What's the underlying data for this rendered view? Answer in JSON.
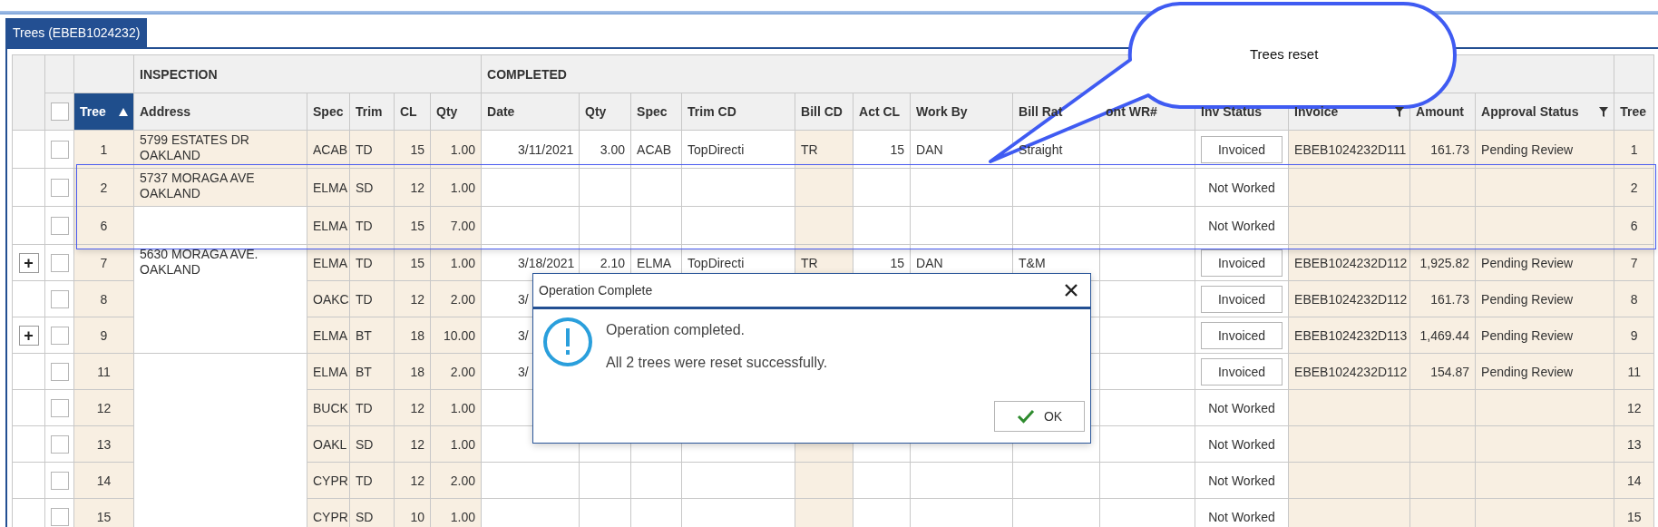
{
  "tab": {
    "label": "Trees (EBEB1024232)",
    "selected": true
  },
  "table": {
    "select_all_checked": false,
    "lead_column": {
      "label": "Tree",
      "sorted": true
    },
    "groups": [
      {
        "label": "INSPECTION",
        "columns": [
          {
            "label": "Address",
            "filter": false
          },
          {
            "label": "Spec",
            "filter": false
          },
          {
            "label": "Trim",
            "filter": false
          },
          {
            "label": "CL",
            "filter": false
          },
          {
            "label": "Qty",
            "filter": false
          }
        ]
      },
      {
        "label": "COMPLETED",
        "columns": [
          {
            "label": "Date",
            "filter": false
          },
          {
            "label": "Qty",
            "filter": false
          },
          {
            "label": "Spec",
            "filter": false
          },
          {
            "label": "Trim CD",
            "filter": false
          },
          {
            "label": "Bill CD",
            "filter": false
          },
          {
            "label": "Act CL",
            "filter": false
          },
          {
            "label": "Work By",
            "filter": false
          },
          {
            "label": "Bill Rat",
            "filter": false
          },
          {
            "label": "ont WR#",
            "filter": false
          },
          {
            "label": "Inv Status",
            "filter": false
          },
          {
            "label": "Invoice",
            "filter": true
          },
          {
            "label": "Amount",
            "filter": false
          },
          {
            "label": "Approval Status",
            "filter": true
          }
        ]
      }
    ],
    "tail_column": {
      "label": "Tree"
    },
    "row_groups": [
      {
        "address": "5799 ESTATES DR\nOAKLAND",
        "highlighted": true,
        "rows": [
          {
            "checked": false,
            "tree": "1",
            "spec": "ACAB",
            "trim": "TD",
            "cl": "15",
            "qty": "1.00",
            "date": "3/11/2021",
            "done_qty": "3.00",
            "done_spec": "ACAB",
            "trim_cd": "TopDirecti",
            "bill_cd": "TR",
            "act_cl": "15",
            "work_by": "DAN",
            "bill_rate": "Straight",
            "inv_status": {
              "text": "Invoiced",
              "kind": "button"
            },
            "invoice": "EBEB1024232D111",
            "amount": "161.73",
            "approval": "Pending Review",
            "tree_end": "1"
          }
        ]
      },
      {
        "address": "5737 MORAGA AVE\nOAKLAND",
        "highlighted": true,
        "rows": [
          {
            "checked": false,
            "tree": "2",
            "spec": "ELMA",
            "trim": "SD",
            "cl": "12",
            "qty": "1.00",
            "inv_status": {
              "text": "Not Worked",
              "kind": "plain"
            },
            "tree_end": "2"
          }
        ]
      },
      {
        "highlighted": false,
        "rows": [
          {
            "checked": false,
            "tree": "6",
            "spec": "ELMA",
            "trim": "TD",
            "cl": "15",
            "qty": "7.00",
            "inv_status": {
              "text": "Not Worked",
              "kind": "plain"
            },
            "tree_end": "6"
          }
        ]
      },
      {
        "address": "5630 MORAGA AVE.\nOAKLAND",
        "highlighted": false,
        "rows": [
          {
            "expander": "+",
            "checked": false,
            "tree": "7",
            "spec": "ELMA",
            "trim": "TD",
            "cl": "15",
            "qty": "1.00",
            "date": "3/18/2021",
            "done_qty": "2.10",
            "done_spec": "ELMA",
            "trim_cd": "TopDirecti",
            "bill_cd": "TR",
            "act_cl": "15",
            "work_by": "DAN",
            "bill_rate": "T&M",
            "inv_status": {
              "text": "Invoiced",
              "kind": "button"
            },
            "invoice": "EBEB1024232D112",
            "amount": "1,925.82",
            "approval": "Pending Review",
            "tree_end": "7"
          },
          {
            "checked": false,
            "tree": "8",
            "spec": "OAKC",
            "trim": "TD",
            "cl": "12",
            "qty": "2.00",
            "date": "3/",
            "inv_status": {
              "text": "Invoiced",
              "kind": "button"
            },
            "invoice": "EBEB1024232D112",
            "amount": "161.73",
            "approval": "Pending Review",
            "tree_end": "8"
          },
          {
            "expander": "+",
            "checked": false,
            "tree": "9",
            "spec": "ELMA",
            "trim": "BT",
            "cl": "18",
            "qty": "10.00",
            "date": "3/",
            "inv_status": {
              "text": "Invoiced",
              "kind": "button"
            },
            "invoice": "EBEB1024232D113",
            "amount": "1,469.44",
            "approval": "Pending Review",
            "tree_end": "9"
          }
        ]
      },
      {
        "highlighted": false,
        "rows": [
          {
            "checked": false,
            "tree": "11",
            "spec": "ELMA",
            "trim": "BT",
            "cl": "18",
            "qty": "2.00",
            "date": "3/",
            "inv_status": {
              "text": "Invoiced",
              "kind": "button"
            },
            "invoice": "EBEB1024232D112",
            "amount": "154.87",
            "approval": "Pending Review",
            "tree_end": "11"
          },
          {
            "checked": false,
            "tree": "12",
            "spec": "BUCK",
            "trim": "TD",
            "cl": "12",
            "qty": "1.00",
            "inv_status": {
              "text": "Not Worked",
              "kind": "plain"
            },
            "tree_end": "12"
          },
          {
            "checked": false,
            "tree": "13",
            "spec": "OAKL",
            "trim": "SD",
            "cl": "12",
            "qty": "1.00",
            "inv_status": {
              "text": "Not Worked",
              "kind": "plain"
            },
            "tree_end": "13"
          },
          {
            "checked": false,
            "tree": "14",
            "spec": "CYPR",
            "trim": "TD",
            "cl": "12",
            "qty": "2.00",
            "inv_status": {
              "text": "Not Worked",
              "kind": "plain"
            },
            "tree_end": "14"
          },
          {
            "checked": false,
            "tree": "15",
            "spec": "CYPR",
            "trim": "SD",
            "cl": "10",
            "qty": "1.00",
            "inv_status": {
              "text": "Not Worked",
              "kind": "plain"
            },
            "tree_end": "15"
          }
        ]
      }
    ]
  },
  "dialog": {
    "title": "Operation Complete",
    "message": "Operation completed.",
    "detail": "All 2 trees were reset successfully.",
    "button": "OK"
  },
  "callout": {
    "text": "Trees reset"
  }
}
